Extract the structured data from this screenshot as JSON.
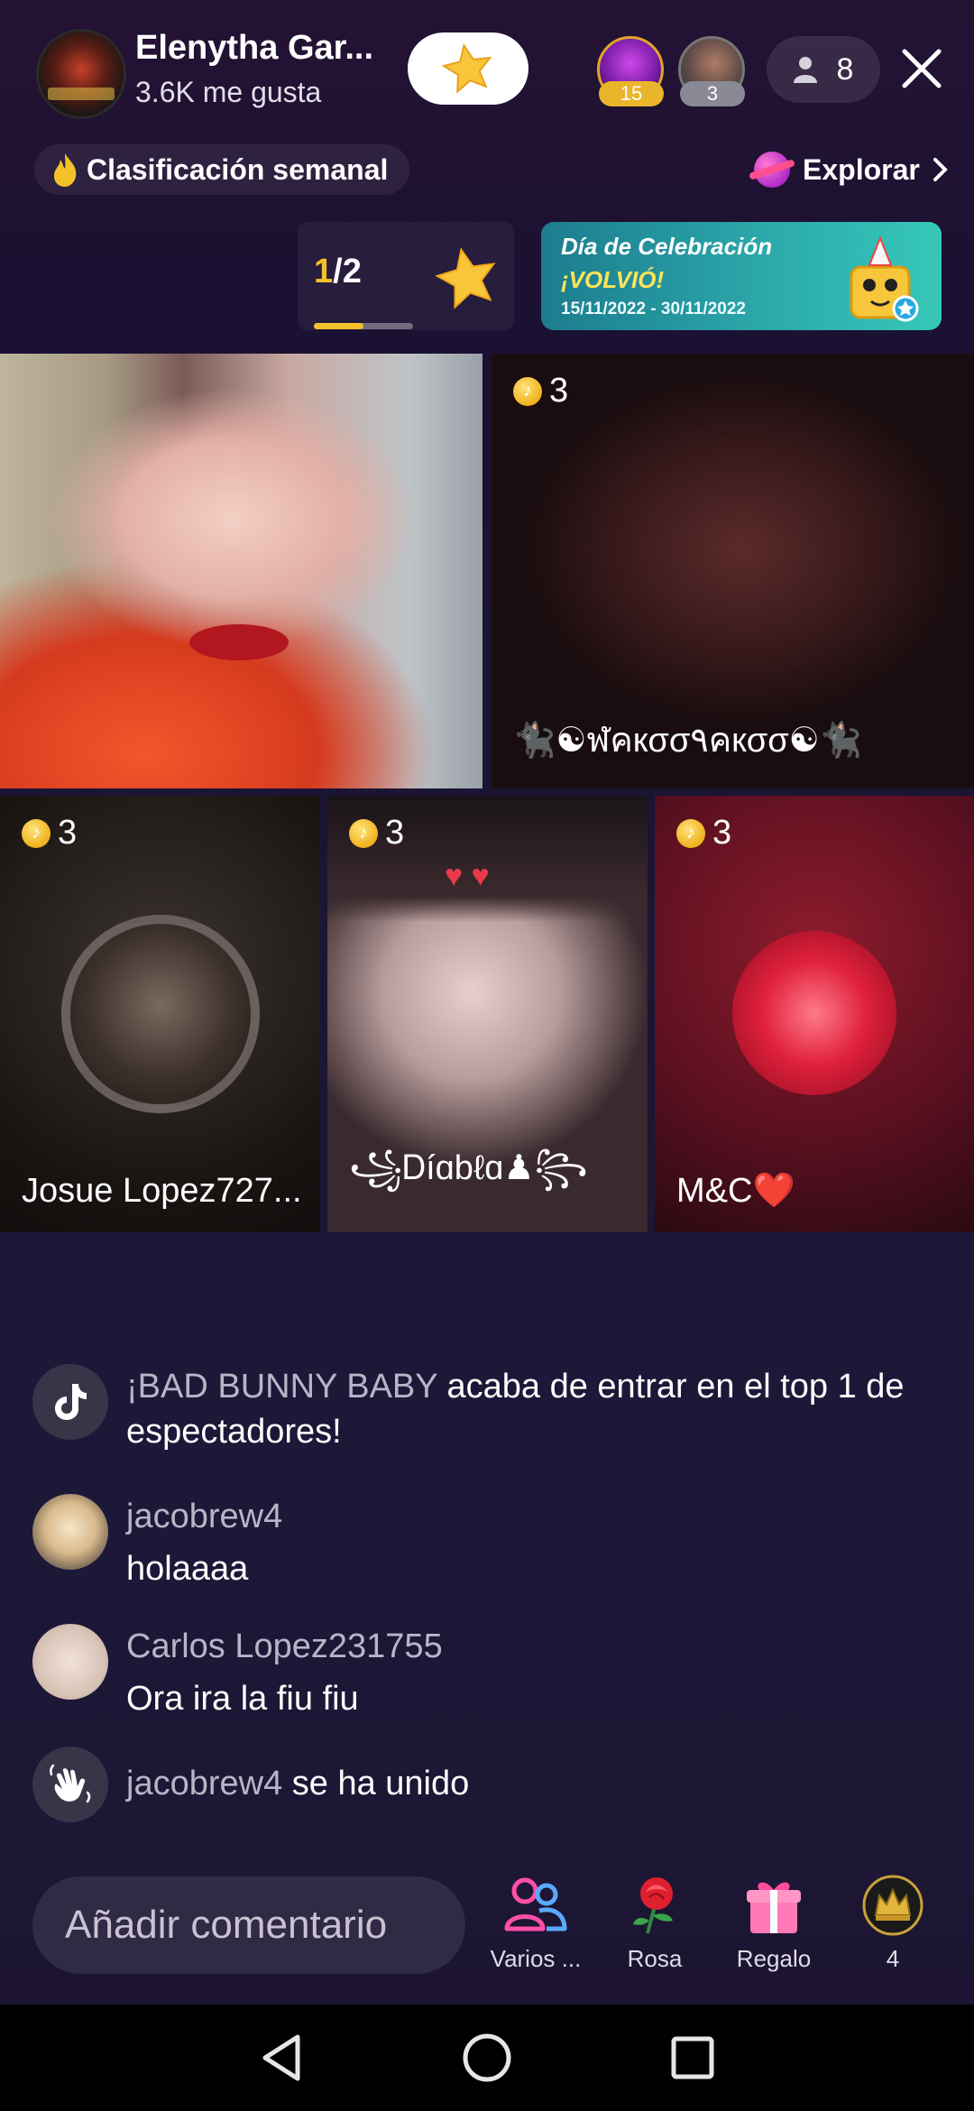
{
  "header": {
    "host_name": "Elenytha Gar...",
    "likes": "3.6K me gusta",
    "viewer_1_badge": "15",
    "viewer_2_badge": "3",
    "viewer_count": "8"
  },
  "ranking": {
    "weekly_label": "Clasificación semanal",
    "explore_label": "Explorar"
  },
  "pager": {
    "current": "1",
    "total": "/2",
    "progress": 0.5
  },
  "banner": {
    "title": "Día de Celebración",
    "subtitle": "¡VOLVIÓ!",
    "dates": "15/11/2022 - 30/11/2022"
  },
  "tiles": [
    {
      "name": "",
      "coins": ""
    },
    {
      "name": "🐈‍⬛☯ฬคкσσ٩คкσσ☯🐈‍⬛",
      "coins": "3"
    },
    {
      "name": "Josue Lopez727...",
      "coins": "3"
    },
    {
      "name": "꧁Ꭰíɑbℓɑ♟꧂",
      "coins": "3"
    },
    {
      "name": "M&C❤️",
      "coins": "3"
    }
  ],
  "chat": [
    {
      "user": "¡BAD BUNNY BABY",
      "text": " acaba de entrar en el top 1 de espectadores!",
      "avatar_icon": "tiktok-icon"
    },
    {
      "user": "jacobrew4",
      "text": "holaaaa",
      "avatar_icon": "avatar"
    },
    {
      "user": "Carlos Lopez231755",
      "text": "Ora ira la fiu fiu",
      "avatar_icon": "avatar"
    },
    {
      "user": "jacobrew4",
      "text": " se ha unido",
      "avatar_icon": "wave-hand-icon"
    }
  ],
  "bottom": {
    "comment_placeholder": "Añadir comentario",
    "actions": [
      {
        "label": "Varios ...",
        "icon": "multi-guest-icon"
      },
      {
        "label": "Rosa",
        "icon": "rose-icon"
      },
      {
        "label": "Regalo",
        "icon": "gift-icon"
      },
      {
        "label": "4",
        "icon": "crown-badge-icon"
      }
    ]
  },
  "colors": {
    "accent_gold": "#f5c12a",
    "banner_teal": "#2fb3b1",
    "background": "#1b1636"
  }
}
